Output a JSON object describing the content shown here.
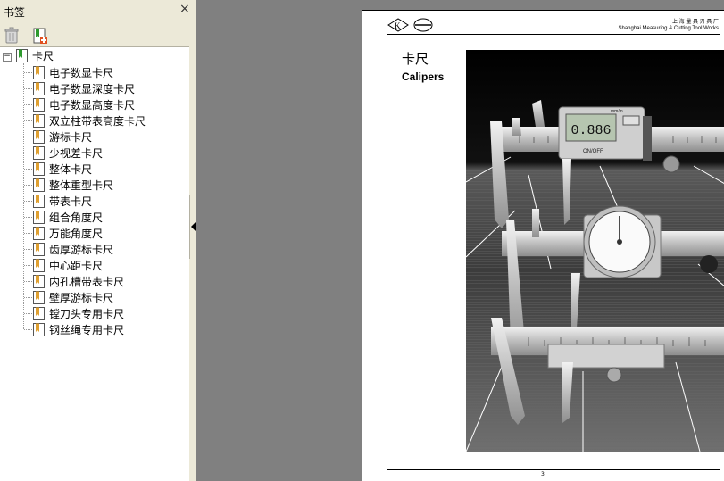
{
  "bookmarks_panel": {
    "title": "书签",
    "close_glyph": "×",
    "root": {
      "label": "卡尺",
      "expander": "⊟",
      "children": [
        {
          "label": "电子数显卡尺"
        },
        {
          "label": "电子数显深度卡尺"
        },
        {
          "label": "电子数显高度卡尺"
        },
        {
          "label": "双立柱带表高度卡尺"
        },
        {
          "label": "游标卡尺"
        },
        {
          "label": "少视差卡尺"
        },
        {
          "label": "整体卡尺"
        },
        {
          "label": "整体重型卡尺"
        },
        {
          "label": "带表卡尺"
        },
        {
          "label": "组合角度尺"
        },
        {
          "label": "万能角度尺"
        },
        {
          "label": "齿厚游标卡尺"
        },
        {
          "label": "中心距卡尺"
        },
        {
          "label": "内孔槽带表卡尺"
        },
        {
          "label": "壁厚游标卡尺"
        },
        {
          "label": "镗刀头专用卡尺"
        },
        {
          "label": "钢丝绳专用卡尺"
        }
      ]
    },
    "toolbar": {
      "delete_icon": "trash-icon",
      "new_bookmark_icon": "new-bookmark-icon"
    }
  },
  "document_page": {
    "heading_cn": "卡尺",
    "heading_en": "Calipers",
    "header_cn": "上 海 量 具 刃 具 厂",
    "header_en": "Shanghai Measuring & Cutting Tool Works",
    "page_number": "3",
    "caliper_readout": "0.886",
    "caliper_button": "ON/OFF",
    "caliper_unit": "mm/in"
  },
  "colors": {
    "panel_bg": "#ece9d8",
    "viewer_bg": "#808080",
    "bookmark_green": "#2e9a2e",
    "bookmark_orange": "#e0a030"
  }
}
